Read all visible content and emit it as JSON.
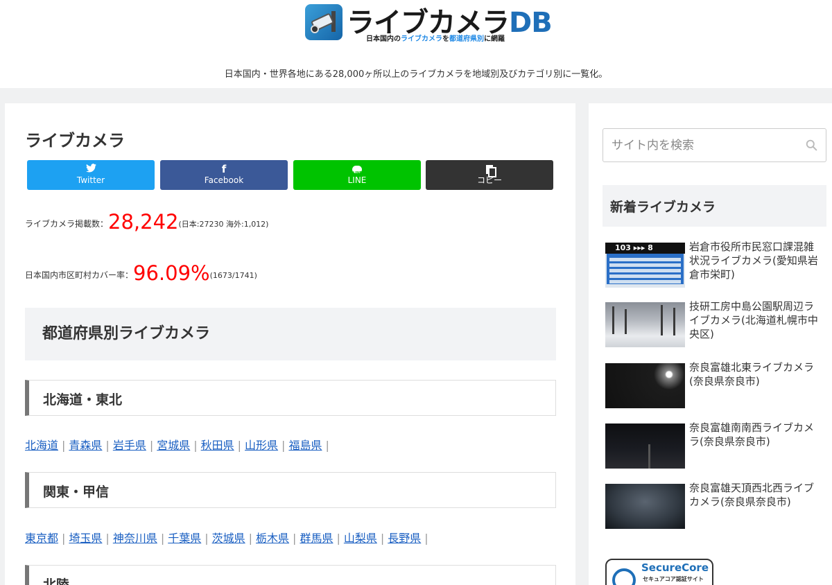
{
  "header": {
    "logo_title": "ライブカメラ",
    "logo_db": "DB",
    "logo_sub_1": "日本国内の",
    "logo_sub_hl_1": "ライブカメラ",
    "logo_sub_2": "を",
    "logo_sub_hl_2": "都道府県別",
    "logo_sub_3": "に網羅",
    "tagline": "日本国内・世界各地にある28,000ヶ所以上のライブカメラを地域別及びカテゴリ別に一覧化。"
  },
  "main": {
    "page_title": "ライブカメラ",
    "share": {
      "twitter": "Twitter",
      "facebook": "Facebook",
      "line": "LINE",
      "copy": "コピー"
    },
    "stats": {
      "count_label": "ライブカメラ掲載数：",
      "count_value": "28,242",
      "count_detail": "(日本:27230 海外:1,012)",
      "cover_label": "日本国内市区町村カバー率：",
      "cover_value": "96.09%",
      "cover_detail": "(1673/1741)"
    },
    "section_title": "都道府県別ライブカメラ",
    "regions": [
      {
        "name": "北海道・東北",
        "prefectures": [
          "北海道",
          "青森県",
          "岩手県",
          "宮城県",
          "秋田県",
          "山形県",
          "福島県"
        ]
      },
      {
        "name": "関東・甲信",
        "prefectures": [
          "東京都",
          "埼玉県",
          "神奈川県",
          "千葉県",
          "茨城県",
          "栃木県",
          "群馬県",
          "山梨県",
          "長野県"
        ]
      },
      {
        "name": "北陸",
        "prefectures": []
      }
    ]
  },
  "sidebar": {
    "search_placeholder": "サイト内を検索",
    "new_title": "新着ライブカメラ",
    "cameras": [
      {
        "title": "岩倉市役所市民窓口課混雑状況ライブカメラ(愛知県岩倉市栄町)",
        "thumb_text": "103 ▸▸▸  8"
      },
      {
        "title": "技研工房中島公園駅周辺ライブカメラ(北海道札幌市中央区)"
      },
      {
        "title": "奈良富雄北東ライブカメラ(奈良県奈良市)"
      },
      {
        "title": "奈良富雄南南西ライブカメラ(奈良県奈良市)"
      },
      {
        "title": "奈良富雄天頂西北西ライブカメラ(奈良県奈良市)"
      }
    ],
    "secure_name": "SecureCore",
    "secure_sub": "セキュアコア認証サイト"
  }
}
